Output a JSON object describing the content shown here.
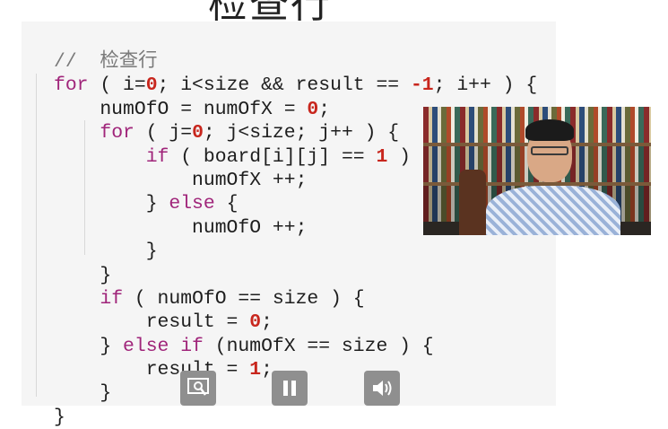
{
  "header": {
    "title": "检查行"
  },
  "code": {
    "lines": [
      [
        {
          "t": "//  检查行",
          "c": "com"
        }
      ],
      [
        {
          "t": "for",
          "c": "kw"
        },
        {
          "t": " ( i="
        },
        {
          "t": "0",
          "c": "num"
        },
        {
          "t": "; i<size && result == "
        },
        {
          "t": "-1",
          "c": "num"
        },
        {
          "t": "; i++ ) {"
        }
      ],
      [
        {
          "t": "    numOfO = numOfX = "
        },
        {
          "t": "0",
          "c": "num"
        },
        {
          "t": ";"
        }
      ],
      [
        {
          "t": "    "
        },
        {
          "t": "for",
          "c": "kw"
        },
        {
          "t": " ( j="
        },
        {
          "t": "0",
          "c": "num"
        },
        {
          "t": "; j<size; j++ ) {"
        }
      ],
      [
        {
          "t": "        "
        },
        {
          "t": "if",
          "c": "kw"
        },
        {
          "t": " ( board[i][j] == "
        },
        {
          "t": "1",
          "c": "num"
        },
        {
          "t": " )"
        }
      ],
      [
        {
          "t": "            numOfX ++;"
        }
      ],
      [
        {
          "t": "        } "
        },
        {
          "t": "else",
          "c": "kw"
        },
        {
          "t": " {"
        }
      ],
      [
        {
          "t": "            numOfO ++;"
        }
      ],
      [
        {
          "t": "        }"
        }
      ],
      [
        {
          "t": "    }"
        }
      ],
      [
        {
          "t": "    "
        },
        {
          "t": "if",
          "c": "kw"
        },
        {
          "t": " ( numOfO == size ) {"
        }
      ],
      [
        {
          "t": "        result = "
        },
        {
          "t": "0",
          "c": "num"
        },
        {
          "t": ";"
        }
      ],
      [
        {
          "t": "    } "
        },
        {
          "t": "else if",
          "c": "kw"
        },
        {
          "t": " (numOfX == size ) {"
        }
      ],
      [
        {
          "t": "        result = "
        },
        {
          "t": "1",
          "c": "num"
        },
        {
          "t": ";"
        }
      ],
      [
        {
          "t": "    }"
        }
      ],
      [
        {
          "t": "}"
        }
      ]
    ]
  },
  "video": {
    "icon": "presenter-video"
  },
  "controls": [
    {
      "name": "zoom-icon-button",
      "icon": "zoom-icon"
    },
    {
      "name": "pause-button",
      "icon": "pause-icon"
    },
    {
      "name": "volume-button",
      "icon": "volume-icon"
    }
  ],
  "colors": {
    "keyword": "#a0257a",
    "number": "#c8261d",
    "comment": "#7a7a7a",
    "control": "#8f8f8f"
  }
}
